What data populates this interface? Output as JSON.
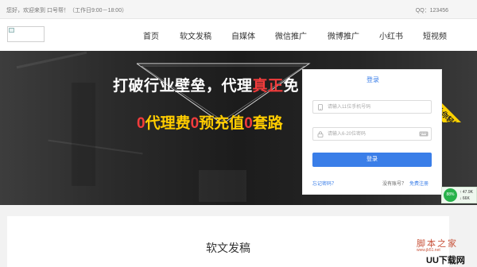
{
  "topbar": {
    "greeting": "您好，欢迎来到 口号帮！（工作日9:00－18:00）",
    "qq": "QQ：123456"
  },
  "nav": {
    "items": [
      "首页",
      "软文发稿",
      "自媒体",
      "微信推广",
      "微博推广",
      "小红书",
      "短视频"
    ]
  },
  "hero": {
    "headline_prefix": "打破行业壁垒，代理",
    "headline_highlight": "真正",
    "headline_suffix": "免",
    "sub_parts": [
      {
        "text": "0",
        "color": "#f23c3c"
      },
      {
        "text": "代理费",
        "color": "#ffcc00"
      },
      {
        "text": "0",
        "color": "#f23c3c"
      },
      {
        "text": "预充值",
        "color": "#ffcc00"
      },
      {
        "text": "0",
        "color": "#f23c3c"
      },
      {
        "text": "套路",
        "color": "#ffcc00"
      }
    ],
    "ribbon": "口号帮让你轻松做"
  },
  "login": {
    "title": "登录",
    "phone_placeholder": "请输入11位手机号码",
    "password_placeholder": "请输入6-20位密码",
    "submit": "登录",
    "forgot": "忘记密码？",
    "register_prompt": "没有账号？",
    "register_link": "免费注册"
  },
  "speed_widget": {
    "percent": "88%",
    "up": "↑ 47.9K",
    "down": "↓ 66K"
  },
  "section": {
    "title": "软文发稿"
  },
  "watermark": {
    "site": "脚本之家",
    "url": "www.jb51.net",
    "brand": "UU下载网"
  },
  "colors": {
    "accent": "#3a7ee8",
    "highlight_red": "#f23c3c",
    "highlight_yellow": "#ffcc00",
    "ribbon": "#ffd200"
  }
}
